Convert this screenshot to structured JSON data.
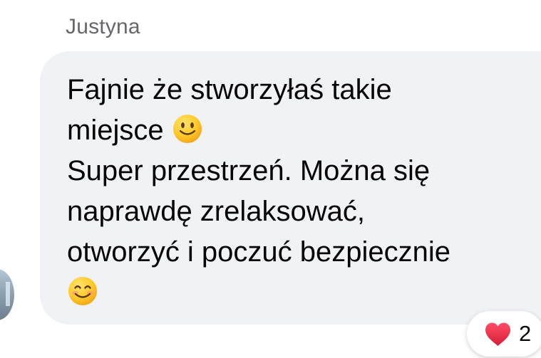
{
  "comment": {
    "author": "Justyna",
    "text_line_1": "Fajnie że stworzyłaś takie",
    "text_line_2": "miejsce",
    "text_line_3": "Super przestrzeń. Można się",
    "text_line_4": "naprawdę zrelaksować,",
    "text_line_5": "otworzyć i poczuć bezpiecznie",
    "emoji_1": "slightly-smiling-face-icon",
    "emoji_2": "smiling-face-with-smiling-eyes-icon"
  },
  "reactions": {
    "icon": "heart-icon",
    "count": "2"
  },
  "colors": {
    "bubble": "#f0f2f5",
    "name": "#65676b",
    "text": "#050505",
    "heart": "#e0283f"
  }
}
